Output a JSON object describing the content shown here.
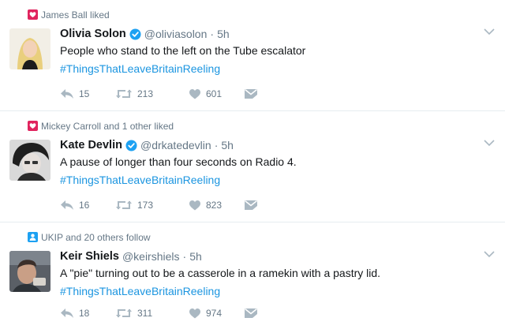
{
  "colors": {
    "like_pink": "#e0245e",
    "follow_blue": "#1da1f2",
    "hashtag_blue": "#1b95e0",
    "muted": "#657786",
    "text": "#14171a",
    "verified_blue": "#1da1f2"
  },
  "tweets": [
    {
      "context_icon": "heart-icon",
      "context": "James Ball liked",
      "name": "Olivia Solon",
      "verified": true,
      "handle": "@oliviasolon",
      "separator": "·",
      "time": "5h",
      "text": "People who stand to the left on the Tube escalator",
      "hashtag": "#ThingsThatLeaveBritainReeling",
      "replies": "15",
      "retweets": "213",
      "likes": "601"
    },
    {
      "context_icon": "heart-icon",
      "context": "Mickey Carroll and 1 other liked",
      "name": "Kate Devlin",
      "verified": true,
      "handle": "@drkatedevlin",
      "separator": "·",
      "time": "5h",
      "text": "A pause of longer than four seconds on Radio 4.",
      "hashtag": "#ThingsThatLeaveBritainReeling",
      "replies": "16",
      "retweets": "173",
      "likes": "823"
    },
    {
      "context_icon": "person-icon",
      "context": "UKIP and 20 others follow",
      "name": "Keir Shiels",
      "verified": false,
      "handle": "@keirshiels",
      "separator": "·",
      "time": "5h",
      "text": "A \"pie\" turning out to be a casserole in a ramekin with a pastry lid.",
      "hashtag": "#ThingsThatLeaveBritainReeling",
      "replies": "18",
      "retweets": "311",
      "likes": "974"
    }
  ]
}
